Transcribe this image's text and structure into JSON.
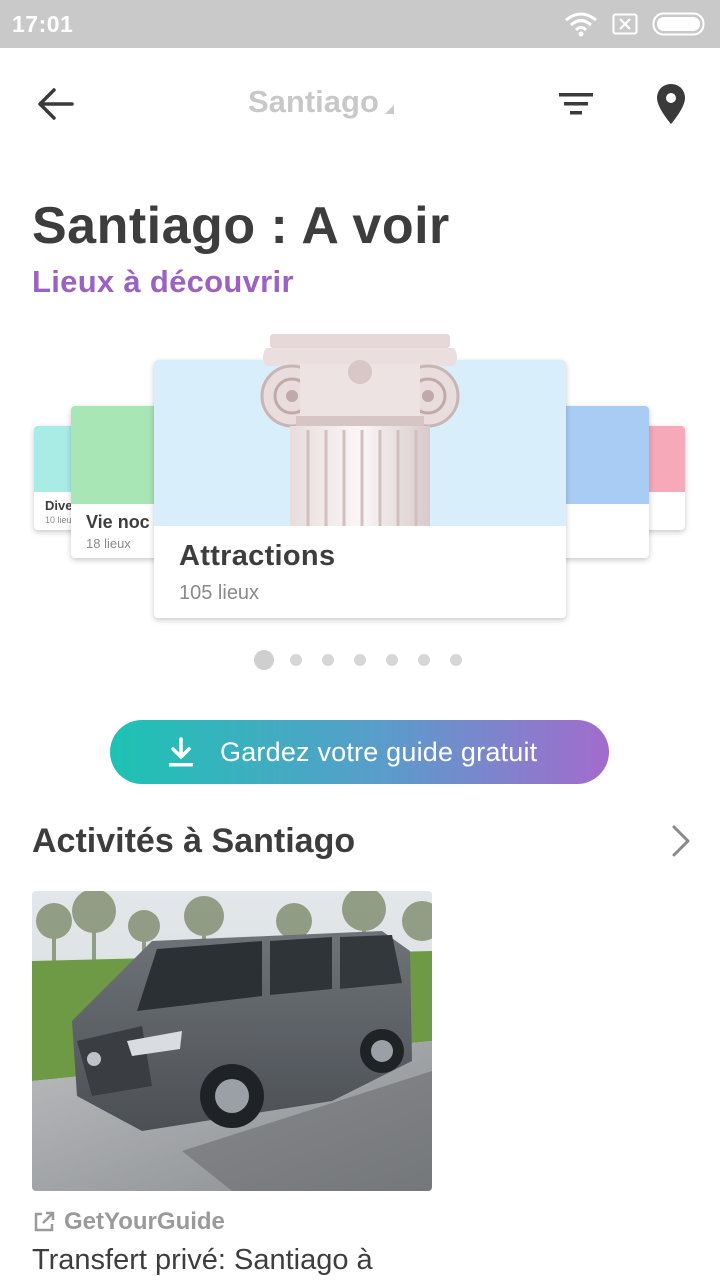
{
  "status_bar": {
    "time": "17:01",
    "icons": [
      "wifi-icon",
      "sim-icon",
      "battery-icon"
    ]
  },
  "toolbar": {
    "title": "Santiago",
    "back_icon": "arrow-left-icon",
    "filter_icon": "filter-icon",
    "map_icon": "map-pin-icon"
  },
  "header": {
    "title": "Santiago : A voir",
    "subtitle": "Lieux à découvrir"
  },
  "carousel": {
    "cards": [
      {
        "title": "Dive",
        "subtitle": "10 lieu",
        "color": "#a9ece6"
      },
      {
        "title": "Vie noc",
        "subtitle": "18 lieux",
        "color": "#a8e6b6"
      },
      {
        "title": "Attractions",
        "subtitle": "105 lieux",
        "color": "#d9eefb"
      },
      {
        "title": "",
        "subtitle": "",
        "color": "#a9ccf5"
      },
      {
        "title": "",
        "subtitle": "",
        "color": "#f6a9b8"
      }
    ],
    "page_count": 7,
    "active_page": 1
  },
  "download_button": {
    "label": "Gardez votre guide gratuit",
    "icon": "download-icon"
  },
  "activities": {
    "title": "Activités à Santiago",
    "chevron_icon": "chevron-right-icon",
    "items": [
      {
        "provider": "GetYourGuide",
        "provider_icon": "external-link-icon",
        "name": "Transfert privé: Santiago à"
      }
    ]
  },
  "colors": {
    "accent_purple": "#9b61c3",
    "gradient_start": "#1dc3b3",
    "gradient_end": "#a36bcd",
    "status_bar": "#c9c9c9"
  }
}
